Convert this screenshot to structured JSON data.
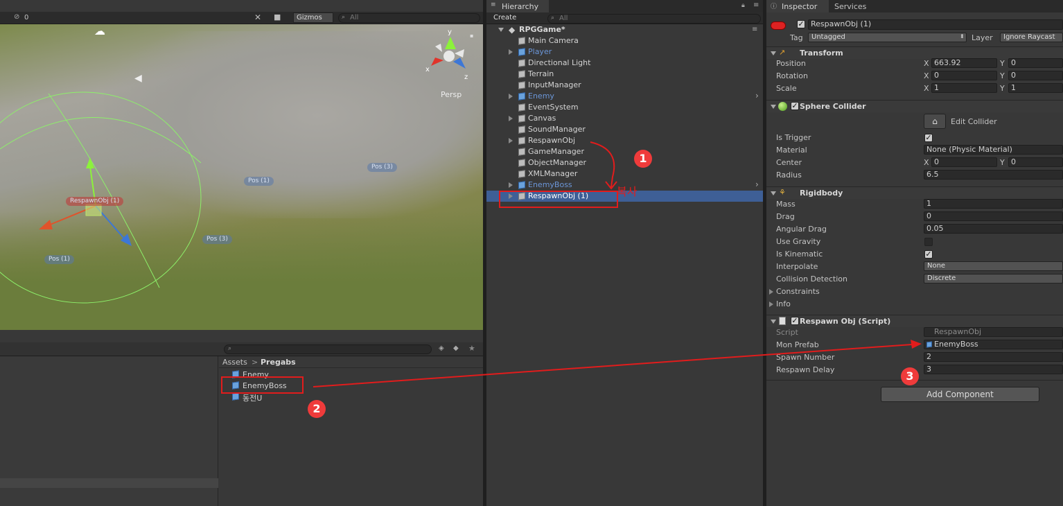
{
  "scene": {
    "counter": "0",
    "gizmos_label": "Gizmos",
    "search_placeholder": "All",
    "persp_label": "Persp",
    "axis_x": "x",
    "axis_y": "y",
    "axis_z": "z",
    "labels": [
      "RespawnObj (1)",
      "Pos (1)",
      "Pos (1)",
      "Pos (3)",
      "Pos (3)"
    ]
  },
  "hierarchy": {
    "tab_label": "Hierarchy",
    "create_label": "Create",
    "search_placeholder": "All",
    "scene_name": "RPGGame*",
    "items": [
      "Main Camera",
      "Player",
      "Directional Light",
      "Terrain",
      "InputManager",
      "Enemy",
      "EventSystem",
      "Canvas",
      "SoundManager",
      "RespawnObj",
      "GameManager",
      "ObjectManager",
      "XMLManager",
      "EnemyBoss",
      "RespawnObj (1)"
    ]
  },
  "project": {
    "breadcrumb_root": "Assets",
    "breadcrumb_sep": ">",
    "breadcrumb_folder": "Pregabs",
    "assets": [
      "Enemy",
      "EnemyBoss",
      "동전U"
    ]
  },
  "inspector": {
    "tab_inspector": "Inspector",
    "tab_services": "Services",
    "object_name": "RespawnObj (1)",
    "tag_label": "Tag",
    "tag_value": "Untagged",
    "layer_label": "Layer",
    "layer_value": "Ignore Raycast",
    "transform": {
      "title": "Transform",
      "position_label": "Position",
      "rotation_label": "Rotation",
      "scale_label": "Scale",
      "x_label": "X",
      "y_label": "Y",
      "pos_x": "663.92",
      "pos_y": "0",
      "rot_x": "0",
      "rot_y": "0",
      "scale_x": "1",
      "scale_y": "1"
    },
    "sphere_collider": {
      "title": "Sphere Collider",
      "edit_collider": "Edit Collider",
      "is_trigger_label": "Is Trigger",
      "is_trigger": true,
      "material_label": "Material",
      "material_value": "None (Physic Material)",
      "center_label": "Center",
      "center_x": "0",
      "center_y": "0",
      "radius_label": "Radius",
      "radius_value": "6.5"
    },
    "rigidbody": {
      "title": "Rigidbody",
      "mass_label": "Mass",
      "mass": "1",
      "drag_label": "Drag",
      "drag": "0",
      "angular_drag_label": "Angular Drag",
      "angular_drag": "0.05",
      "use_gravity_label": "Use Gravity",
      "use_gravity": false,
      "is_kinematic_label": "Is Kinematic",
      "is_kinematic": true,
      "interpolate_label": "Interpolate",
      "interpolate": "None",
      "collision_label": "Collision Detection",
      "collision": "Discrete",
      "constraints_label": "Constraints",
      "info_label": "Info"
    },
    "script": {
      "title": "Respawn Obj (Script)",
      "script_label": "Script",
      "script_value": "RespawnObj",
      "mon_prefab_label": "Mon Prefab",
      "mon_prefab": "EnemyBoss",
      "spawn_number_label": "Spawn Number",
      "spawn_number": "2",
      "respawn_delay_label": "Respawn Delay",
      "respawn_delay": "3"
    },
    "add_component": "Add Component"
  },
  "annotations": {
    "step1": "1",
    "step2": "2",
    "step3": "3",
    "copy_text": "복사"
  },
  "colors": {
    "annotation_red": "#e21c1c",
    "prefab_blue": "#6b96d8",
    "selection": "#3e5f96"
  }
}
